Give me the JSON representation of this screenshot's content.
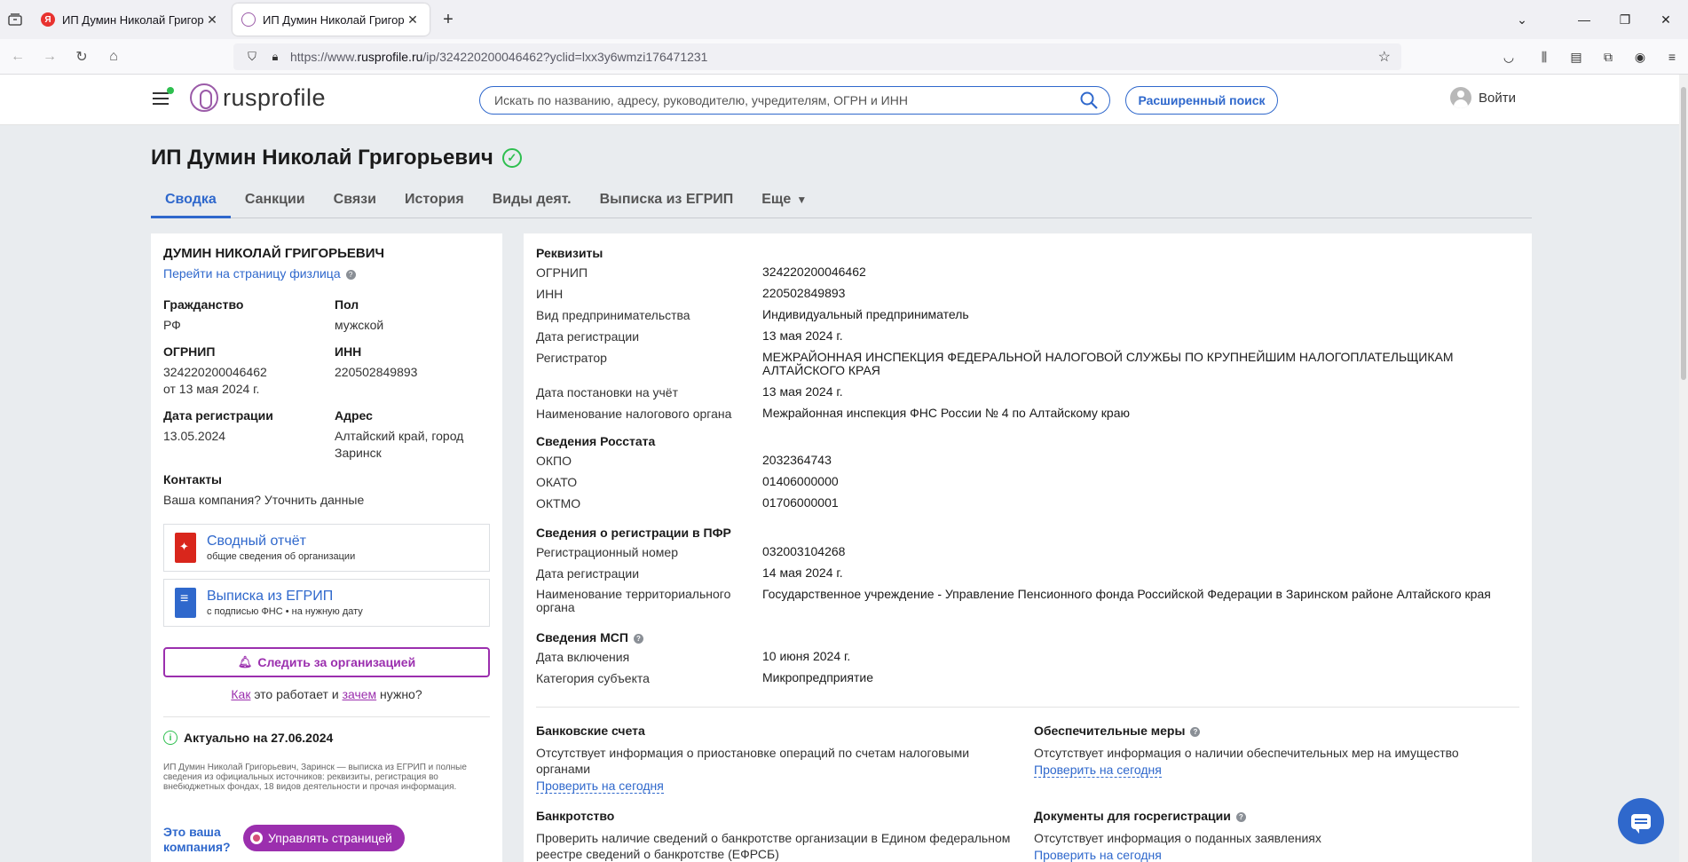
{
  "browser": {
    "tabs": [
      {
        "title": "ИП Думин Николай Григорьевич",
        "favicon": "yandex-icon"
      },
      {
        "title": "ИП Думин Николай Григорьевич",
        "favicon": "rusprofile-icon"
      }
    ],
    "url_prefix": "https://www.",
    "url_host": "rusprofile.ru",
    "url_path": "/ip/324220200046462?yclid=lxx3y6wmzi176471231"
  },
  "header": {
    "logo_text": "rusprofile",
    "search_placeholder": "Искать по названию, адресу, руководителю, учредителям, ОГРН и ИНН",
    "advanced_search": "Расширенный поиск",
    "login": "Войти"
  },
  "page": {
    "title": "ИП Думин Николай Григорьевич",
    "tabs": [
      "Сводка",
      "Санкции",
      "Связи",
      "История",
      "Виды деят.",
      "Выписка из ЕГРИП",
      "Еще"
    ]
  },
  "left": {
    "fullname": "ДУМИН НИКОЛАЙ ГРИГОРЬЕВИЧ",
    "fiz_link": "Перейти на страницу физлица",
    "citizenship_label": "Гражданство",
    "citizenship": "РФ",
    "sex_label": "Пол",
    "sex": "мужской",
    "ogrnip_label": "ОГРНИП",
    "ogrnip": "324220200046462",
    "ogrnip_date": "от 13 мая 2024 г.",
    "inn_label": "ИНН",
    "inn": "220502849893",
    "regdate_label": "Дата регистрации",
    "regdate": "13.05.2024",
    "address_label": "Адрес",
    "address": "Алтайский край, город Заринск",
    "contacts_label": "Контакты",
    "contacts_link": "Ваша компания? Уточнить данные",
    "report_title": "Сводный отчёт",
    "report_sub": "общие сведения об организации",
    "extract_title": "Выписка из ЕГРИП",
    "extract_sub": "с подписью ФНС • на нужную дату",
    "follow_btn": "Следить за организацией",
    "how_1": "Как",
    "how_2": " это работает и ",
    "how_3": "зачем",
    "how_4": " нужно?",
    "actual": "Актуально на 27.06.2024",
    "desc": "ИП Думин Николай Григорьевич, Заринск — выписка из ЕГРИП и полные сведения из официальных источников: реквизиты, регистрация во внебюджетных фондах, 18 видов деятельности и прочая информация.",
    "your_company": "Это ваша компания?",
    "manage_btn": "Управлять страницей"
  },
  "right": {
    "req_title": "Реквизиты",
    "req": [
      {
        "k": "ОГРНИП",
        "v": "324220200046462"
      },
      {
        "k": "ИНН",
        "v": "220502849893"
      },
      {
        "k": "Вид предпринимательства",
        "v": "Индивидуальный предприниматель"
      },
      {
        "k": "Дата регистрации",
        "v": "13 мая 2024 г."
      },
      {
        "k": "Регистратор",
        "v": "МЕЖРАЙОННАЯ ИНСПЕКЦИЯ ФЕДЕРАЛЬНОЙ НАЛОГОВОЙ СЛУЖБЫ ПО КРУПНЕЙШИМ НАЛОГОПЛАТЕЛЬЩИКАМ АЛТАЙСКОГО КРАЯ"
      },
      {
        "k": "Дата постановки на учёт",
        "v": "13 мая 2024 г."
      },
      {
        "k": "Наименование налогового органа",
        "v": "Межрайонная инспекция ФНС России № 4 по Алтайскому краю"
      }
    ],
    "rosstat_title": "Сведения Росстата",
    "rosstat": [
      {
        "k": "ОКПО",
        "v": "2032364743"
      },
      {
        "k": "ОКАТО",
        "v": "01406000000"
      },
      {
        "k": "ОКТМО",
        "v": "01706000001"
      }
    ],
    "pfr_title": "Сведения о регистрации в ПФР",
    "pfr": [
      {
        "k": "Регистрационный номер",
        "v": "032003104268"
      },
      {
        "k": "Дата регистрации",
        "v": "14 мая 2024 г."
      },
      {
        "k": "Наименование территориального органа",
        "v": "Государственное учреждение - Управление Пенсионного фонда Российской Федерации в Заринском районе Алтайского края"
      }
    ],
    "msp_title": "Сведения МСП",
    "msp": [
      {
        "k": "Дата включения",
        "v": "10 июня 2024 г."
      },
      {
        "k": "Категория субъекта",
        "v": "Микропредприятие"
      }
    ],
    "bank_title": "Банковские счета",
    "bank_desc": "Отсутствует информация о приостановке операций по счетам налоговыми органами",
    "bank_link": "Проверить на сегодня",
    "secure_title": "Обеспечительные меры",
    "secure_desc": "Отсутствует информация о наличии обеспечительных мер на имущество",
    "secure_link": "Проверить на сегодня",
    "bankrupt_title": "Банкротство",
    "bankrupt_desc": "Проверить наличие сведений о банкротстве организации в Едином федеральном реестре сведений о банкротстве (ЕФРСБ)",
    "docs_title": "Документы для госрегистрации",
    "docs_desc": "Отсутствует информация о поданных заявлениях",
    "docs_link": "Проверить на сегодня"
  }
}
